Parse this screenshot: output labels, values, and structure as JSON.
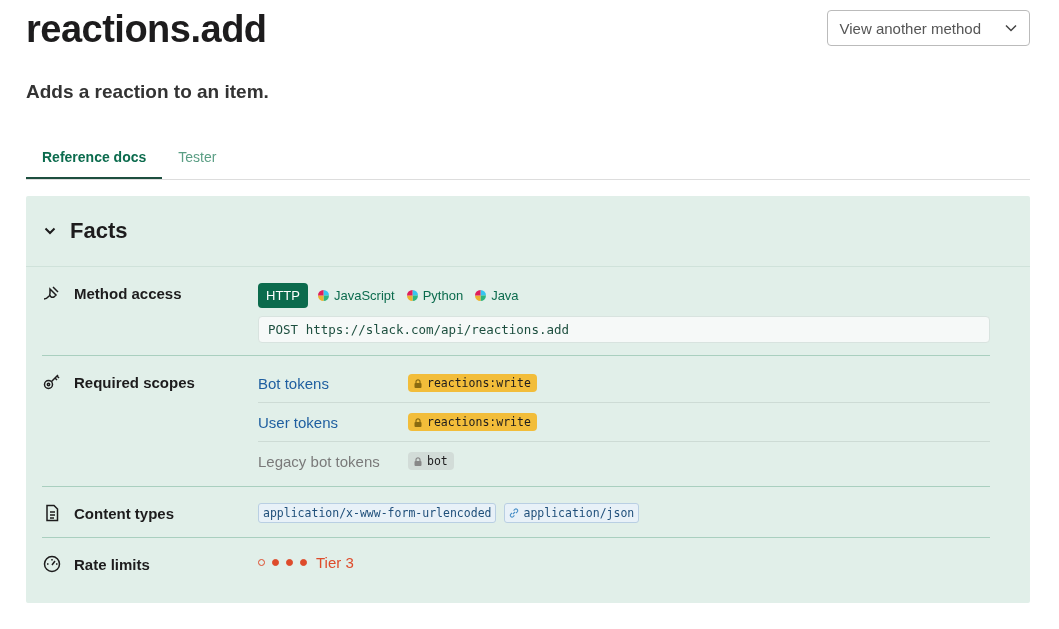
{
  "title": "reactions.add",
  "method_picker": {
    "label": "View another method"
  },
  "subtitle": "Adds a reaction to an item.",
  "tabs": [
    {
      "label": "Reference docs",
      "selected": true
    },
    {
      "label": "Tester",
      "selected": false
    }
  ],
  "facts": {
    "title": "Facts",
    "expanded": true,
    "method_access": {
      "label": "Method access",
      "languages": [
        {
          "label": "HTTP",
          "selected": true
        },
        {
          "label": "JavaScript",
          "selected": false
        },
        {
          "label": "Python",
          "selected": false
        },
        {
          "label": "Java",
          "selected": false
        }
      ],
      "endpoint": "POST https://slack.com/api/reactions.add"
    },
    "required_scopes": {
      "label": "Required scopes",
      "rows": [
        {
          "token_type": "Bot tokens",
          "scope": "reactions:write",
          "disabled": false
        },
        {
          "token_type": "User tokens",
          "scope": "reactions:write",
          "disabled": false
        },
        {
          "token_type": "Legacy bot tokens",
          "scope": "bot",
          "disabled": true
        }
      ]
    },
    "content_types": {
      "label": "Content types",
      "items": [
        {
          "kind": "plain",
          "text": "application/x-www-form-urlencoded"
        },
        {
          "kind": "link",
          "text": "application/json"
        }
      ]
    },
    "rate_limits": {
      "label": "Rate limits",
      "dots": [
        {
          "filled": false
        },
        {
          "filled": true
        },
        {
          "filled": true
        },
        {
          "filled": true
        }
      ],
      "tier": "Tier 3"
    }
  }
}
